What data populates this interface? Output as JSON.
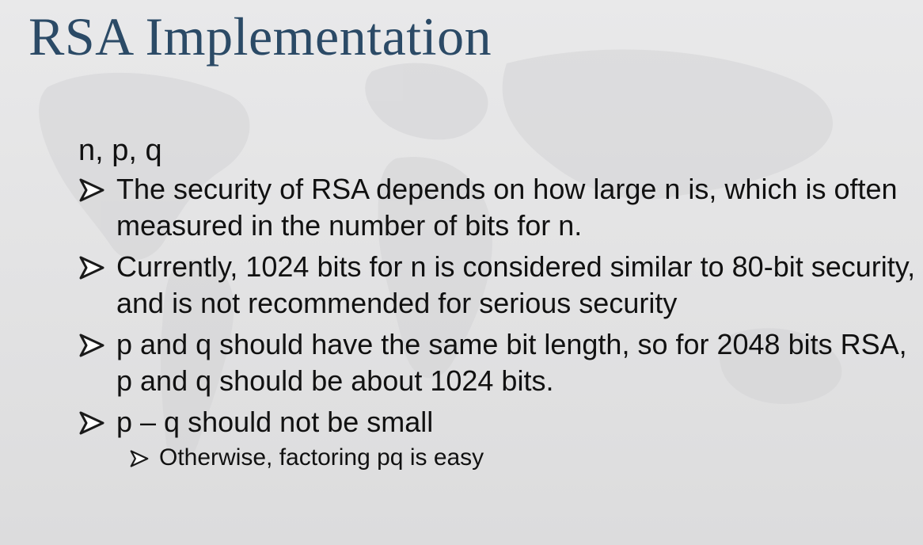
{
  "slide": {
    "title": "RSA Implementation",
    "subheading": "n, p, q",
    "bullet_icon": "arrowhead-bullet-icon",
    "bullets": [
      {
        "text": "The security of RSA depends on how large n is, which is often measured in the number of bits for n."
      },
      {
        "text": "Currently, 1024 bits for n is considered similar to 80-bit security, and is not recommended for serious security"
      },
      {
        "text": "p and q should have the same bit length, so for 2048 bits RSA, p and q should be about 1024 bits."
      },
      {
        "text": "p – q should not be small"
      }
    ],
    "sub_bullets": [
      {
        "text": "Otherwise, factoring pq is easy"
      }
    ],
    "colors": {
      "title": "#2b4a66",
      "body_text": "#111111",
      "background": "#e4e4e5"
    }
  }
}
